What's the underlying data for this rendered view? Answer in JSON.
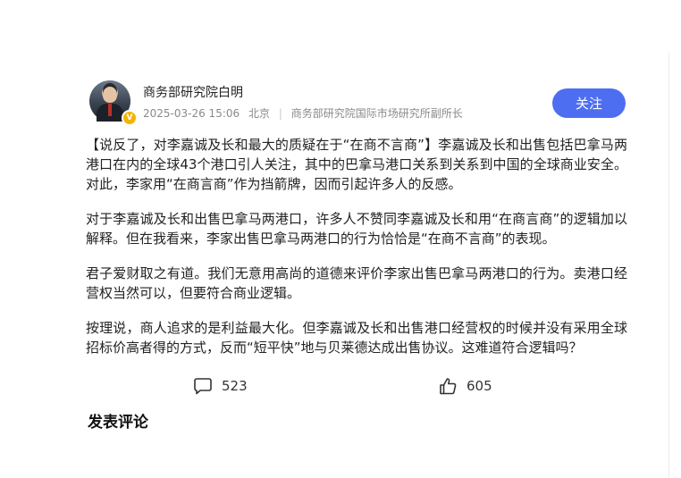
{
  "author": {
    "name": "商务部研究院白明",
    "date": "2025-03-26 15:06",
    "location": "北京",
    "title": "商务部研究院国际市场研究所副所长"
  },
  "follow_label": "关注",
  "paragraphs": [
    "【说反了，对李嘉诚及长和最大的质疑在于“在商不言商”】李嘉诚及长和出售包括巴拿马两港口在内的全球43个港口引人关注，其中的巴拿马港口关系到关系到中国的全球商业安全。对此，李家用“在商言商”作为挡箭牌，因而引起许多人的反感。",
    "对于李嘉诚及长和出售巴拿马两港口，许多人不赞同李嘉诚及长和用“在商言商”的逻辑加以解释。但在我看来，李家出售巴拿马两港口的行为恰恰是“在商不言商”的表现。",
    "君子爱财取之有道。我们无意用高尚的道德来评价李家出售巴拿马两港口的行为。卖港口经营权当然可以，但要符合商业逻辑。",
    "按理说，商人追求的是利益最大化。但李嘉诚及长和出售港口经营权的时候并没有采用全球招标价高者得的方式，反而“短平快”地与贝莱德达成出售协议。这难道符合逻辑吗？"
  ],
  "stats": {
    "comments": "523",
    "likes": "605"
  },
  "comments_section_title": "发表评论",
  "colors": {
    "accent": "#4e6ef2",
    "verify_badge": "#f5b400",
    "meta_text": "#8a8a8a"
  },
  "icons": {
    "comment": "comment-icon",
    "like": "thumbs-up-icon",
    "verified": "verified-badge-icon"
  }
}
